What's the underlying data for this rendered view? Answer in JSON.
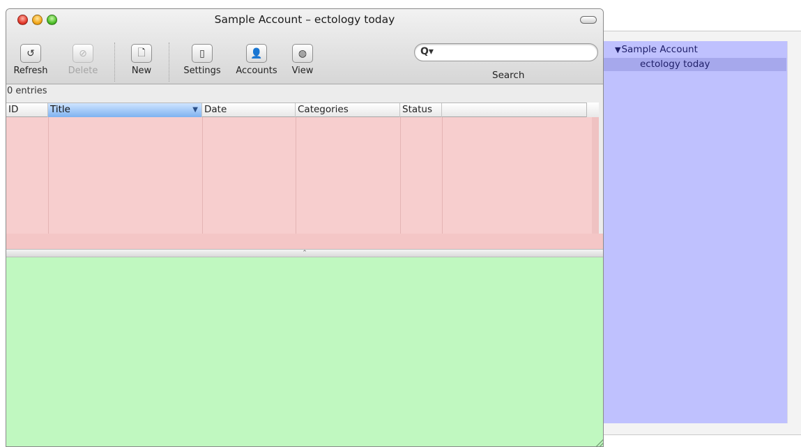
{
  "window": {
    "title": "Sample Account – ectology today"
  },
  "toolbar": {
    "refresh_label": "Refresh",
    "delete_label": "Delete",
    "new_label": "New",
    "settings_label": "Settings",
    "accounts_label": "Accounts",
    "view_label": "View",
    "refresh_icon": "↺",
    "delete_icon": "⊘",
    "new_icon": "🗋",
    "settings_icon": "▯",
    "accounts_icon": "👤",
    "view_icon": "◍"
  },
  "search": {
    "label": "Search",
    "value": "",
    "icon": "Q▾"
  },
  "list": {
    "entries_text": "0 entries",
    "columns": [
      "ID",
      "Title",
      "Date",
      "Categories",
      "Status"
    ],
    "sorted_column": "Title",
    "sort_arrow": "▼",
    "rows": []
  },
  "splitter": {
    "glyph": "⌃"
  },
  "sidebar": {
    "root_arrow": "▼",
    "root_label": "Sample Account",
    "child_label": "ectology today"
  },
  "colors": {
    "list_bg": "#f7cece",
    "preview_bg": "#c0f8c0",
    "sidebar_bg": "#bfc1fe",
    "sidebar_selected": "#a6a8ec"
  }
}
